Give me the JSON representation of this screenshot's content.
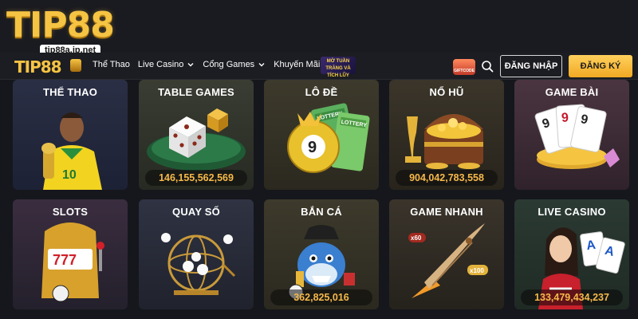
{
  "brand": {
    "logo": "TIP88",
    "url": "tip88a.jp.net"
  },
  "nav": {
    "logo": "TIP88",
    "links": [
      {
        "label": "Thể Thao",
        "has_dropdown": false
      },
      {
        "label": "Live Casino",
        "has_dropdown": true
      },
      {
        "label": "Cổng Games",
        "has_dropdown": true
      },
      {
        "label": "Khuyến Mãi",
        "has_dropdown": false
      }
    ],
    "promo_label": "MỜ TUẦN TRĂNG VÀ TÍCH LŨY",
    "giftcode_label": "GIFTCODE",
    "login": "ĐĂNG NHẬP",
    "register": "ĐĂNG KÝ"
  },
  "games": [
    {
      "title": "THỂ THAO",
      "counter": ""
    },
    {
      "title": "TABLE GAMES",
      "counter": "146,155,562,569"
    },
    {
      "title": "LÔ ĐỀ",
      "counter": ""
    },
    {
      "title": "NỔ HŨ",
      "counter": "904,042,783,558"
    },
    {
      "title": "GAME BÀI",
      "counter": ""
    },
    {
      "title": "SLOTS",
      "counter": ""
    },
    {
      "title": "QUAY SỐ",
      "counter": ""
    },
    {
      "title": "BẮN CÁ",
      "counter": "362,825,016"
    },
    {
      "title": "GAME NHANH",
      "counter": ""
    },
    {
      "title": "LIVE CASINO",
      "counter": "133,479,434,237"
    }
  ],
  "art_labels": {
    "lottery": "LOTTERY",
    "ball_number": "9",
    "slot_digits": "777",
    "multiplier_60": "x60",
    "multiplier_100": "x100",
    "card_rank": "9",
    "card_ace": "A"
  },
  "colors": {
    "accent_gold": "#f6c443",
    "counter_text": "#f6b94a",
    "register_bg": "#f1a823"
  }
}
